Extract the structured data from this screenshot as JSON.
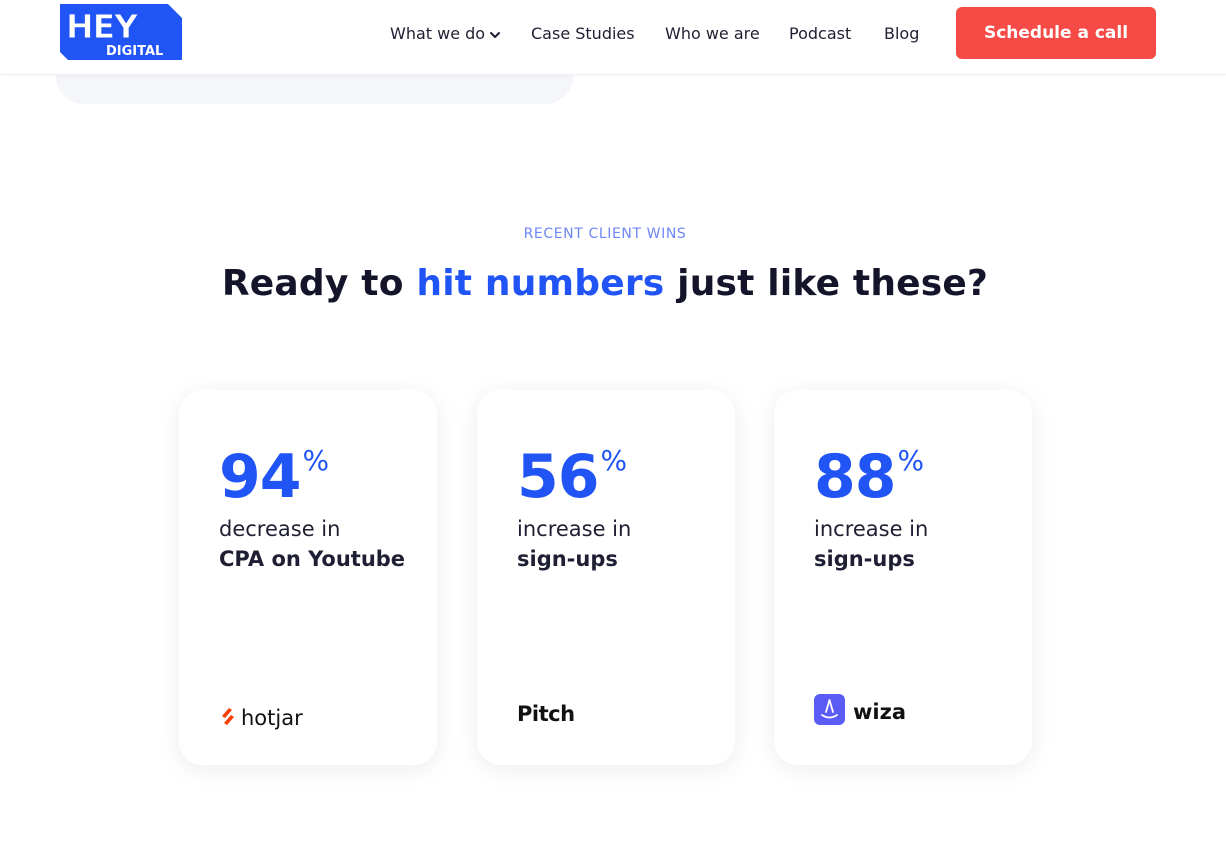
{
  "header": {
    "logo_top": "HEY",
    "logo_bottom": "DIGITAL",
    "nav": [
      {
        "label": "What we do"
      },
      {
        "label": "Case Studies"
      },
      {
        "label": "Who we are"
      },
      {
        "label": "Podcast"
      },
      {
        "label": "Blog"
      }
    ],
    "cta_label": "Schedule a call"
  },
  "section": {
    "eyebrow": "RECENT CLIENT WINS",
    "headline_before": "Ready to ",
    "headline_highlight": "hit numbers",
    "headline_after": " just like these?"
  },
  "cards": [
    {
      "value": "94",
      "unit": "%",
      "line1": "decrease in",
      "line2": "CPA on Youtube",
      "brand": "hotjar",
      "brand_icon": "hotjar-logo-icon"
    },
    {
      "value": "56",
      "unit": "%",
      "line1": "increase in",
      "line2": "sign-ups",
      "brand": "Pitch",
      "brand_icon": "pitch-logo"
    },
    {
      "value": "88",
      "unit": "%",
      "line1": "increase in",
      "line2": "sign-ups",
      "brand": "wiza",
      "brand_icon": "wiza-logo-icon"
    }
  ],
  "colors": {
    "accent_blue": "#2054f5",
    "cta_red": "#f64a46",
    "eyebrow_blue": "#6f86f5",
    "hotjar_orange": "#ff3c00",
    "wiza_purple": "#5b5bf5"
  }
}
